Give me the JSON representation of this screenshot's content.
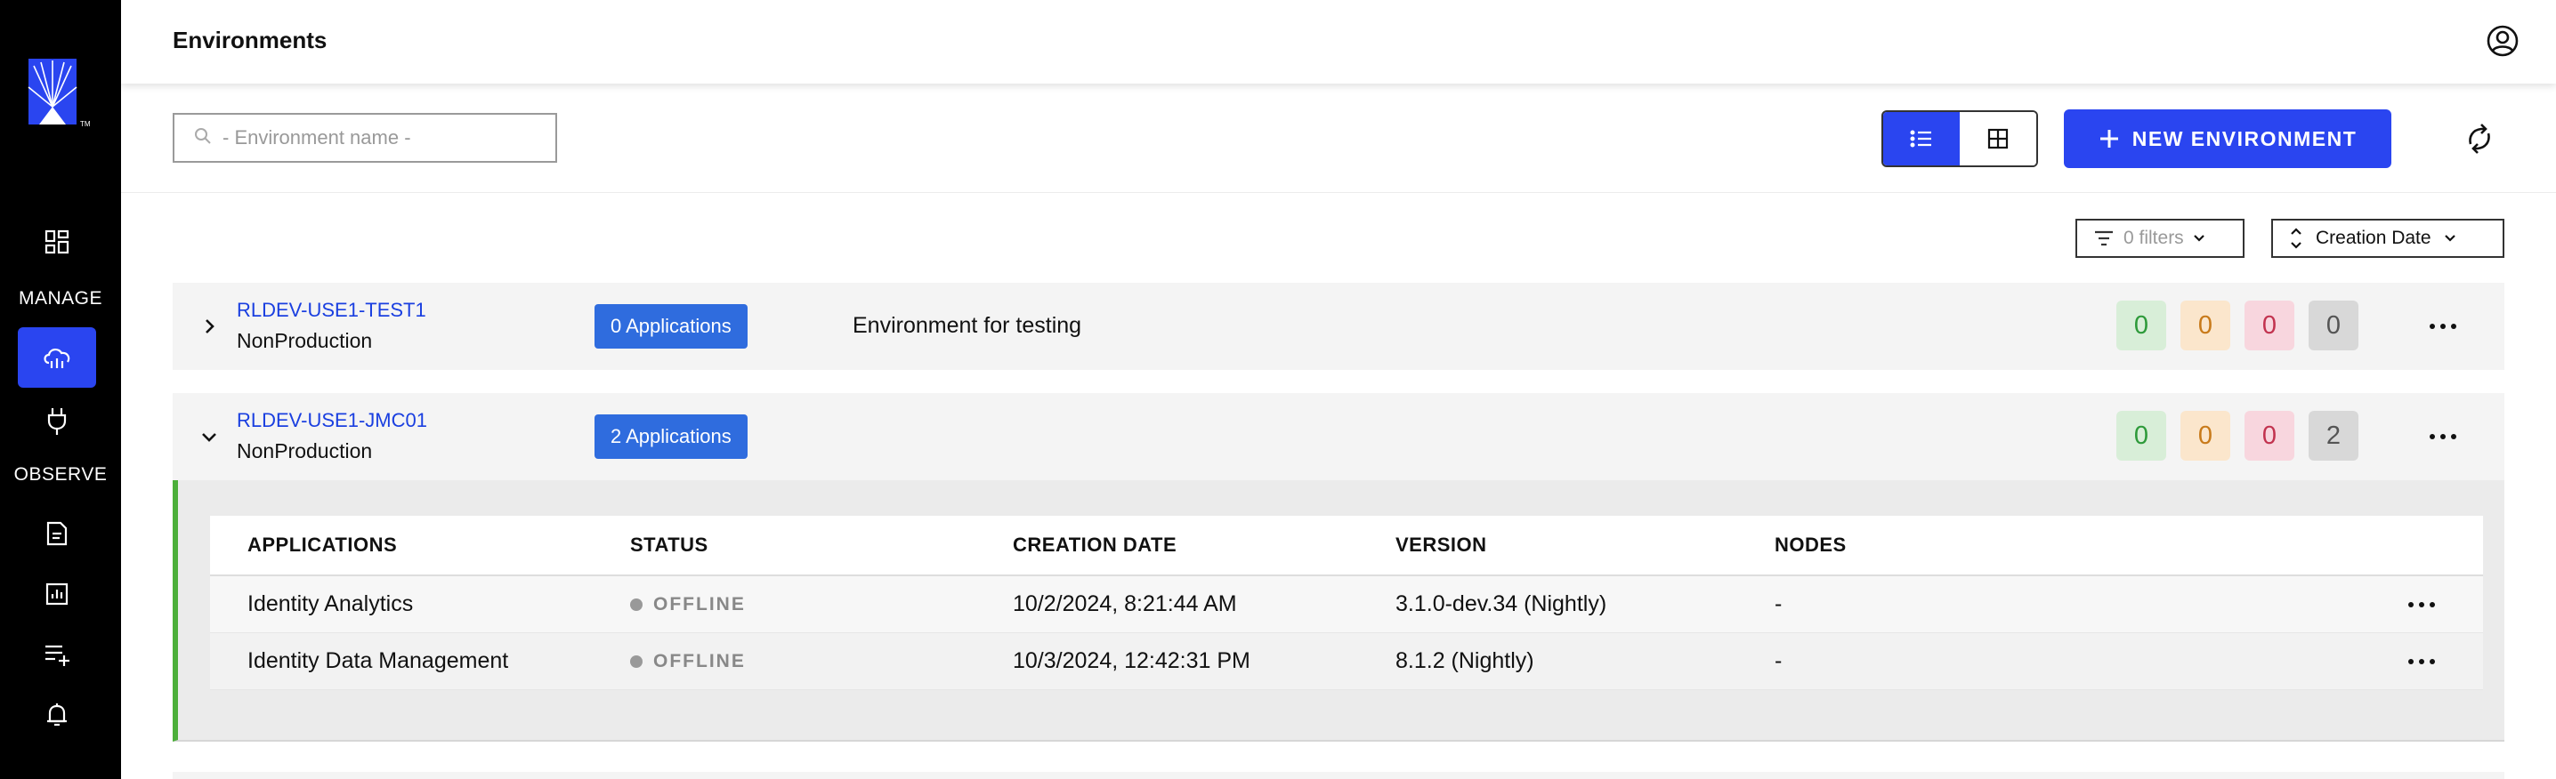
{
  "header": {
    "title": "Environments"
  },
  "sidebar": {
    "sections": [
      {
        "label": "MANAGE"
      },
      {
        "label": "OBSERVE"
      }
    ]
  },
  "toolbar": {
    "search_placeholder": "- Environment name -",
    "new_environment_label": "NEW ENVIRONMENT",
    "filters_label": "0 filters",
    "sort_label": "Creation Date"
  },
  "environments": [
    {
      "name": "RLDEV-USE1-TEST1",
      "type": "NonProduction",
      "applications_badge": "0 Applications",
      "description": "Environment for testing",
      "counts": [
        "0",
        "0",
        "0",
        "0"
      ],
      "expanded": false
    },
    {
      "name": "RLDEV-USE1-JMC01",
      "type": "NonProduction",
      "applications_badge": "2 Applications",
      "description": "",
      "counts": [
        "0",
        "0",
        "0",
        "2"
      ],
      "expanded": true
    }
  ],
  "apps_table": {
    "headers": [
      "APPLICATIONS",
      "STATUS",
      "CREATION DATE",
      "VERSION",
      "NODES"
    ],
    "rows": [
      {
        "application": "Identity Analytics",
        "status": "OFFLINE",
        "creation_date": "10/2/2024, 8:21:44 AM",
        "version": "3.1.0-dev.34 (Nightly)",
        "nodes": "-"
      },
      {
        "application": "Identity Data Management",
        "status": "OFFLINE",
        "creation_date": "10/3/2024, 12:42:31 PM",
        "version": "8.1.2 (Nightly)",
        "nodes": "-"
      }
    ]
  },
  "colors": {
    "accent": "#2a45f0",
    "badge": "#2f6cde",
    "expanded_border": "#4caf3a",
    "sidebar": "#000000"
  }
}
